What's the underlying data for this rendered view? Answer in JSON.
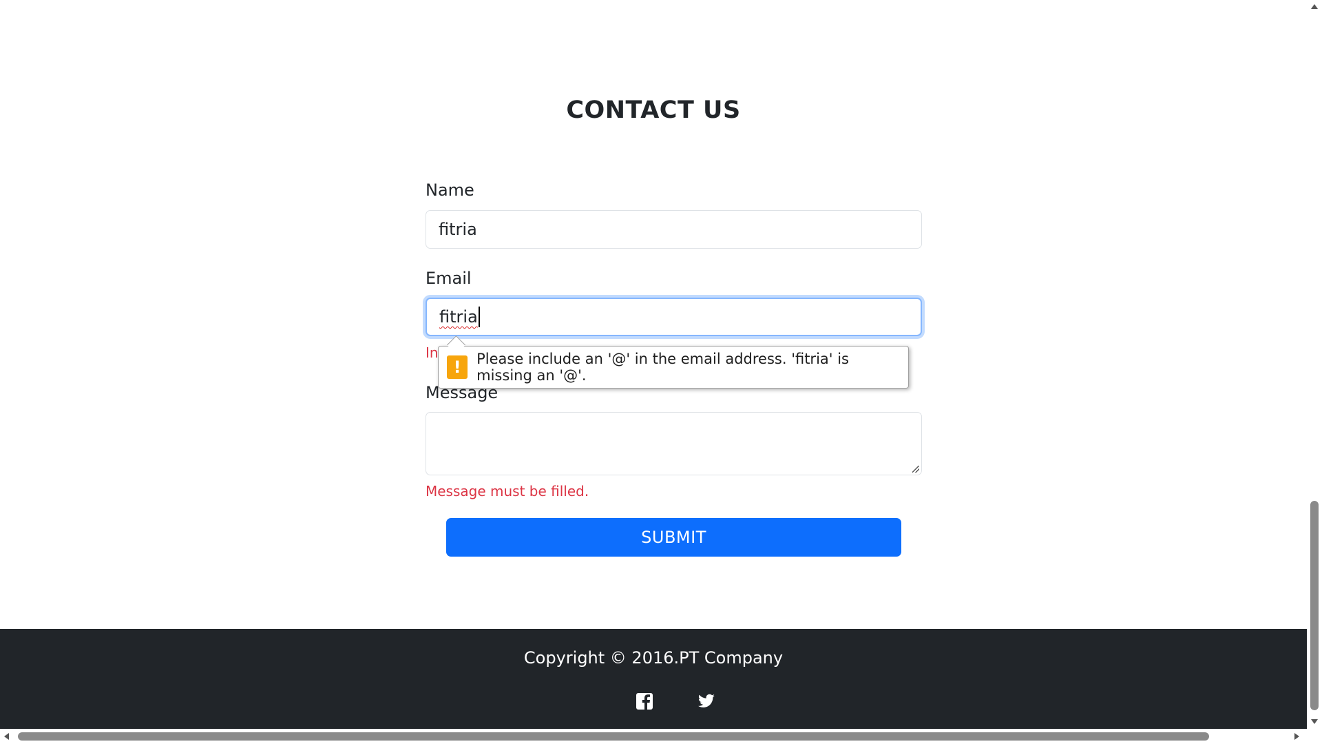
{
  "page": {
    "title": "CONTACT US"
  },
  "form": {
    "name_label": "Name",
    "name_value": "fitria",
    "email_label": "Email",
    "email_value": "fitria",
    "email_error_partial": "In",
    "message_label": "Message",
    "message_value": "",
    "message_error": "Message must be filled.",
    "submit_label": "SUBMIT"
  },
  "validation_tooltip": {
    "icon": "warning-icon",
    "text": "Please include an '@' in the email address. 'fitria' is missing an '@'."
  },
  "footer": {
    "copyright": "Copyright © 2016.PT Company",
    "social": [
      {
        "name": "facebook-icon"
      },
      {
        "name": "twitter-icon"
      }
    ]
  },
  "colors": {
    "primary": "#0d6efd",
    "error": "#dc3545",
    "footer_bg": "#212529",
    "warning": "#f7a50c"
  }
}
